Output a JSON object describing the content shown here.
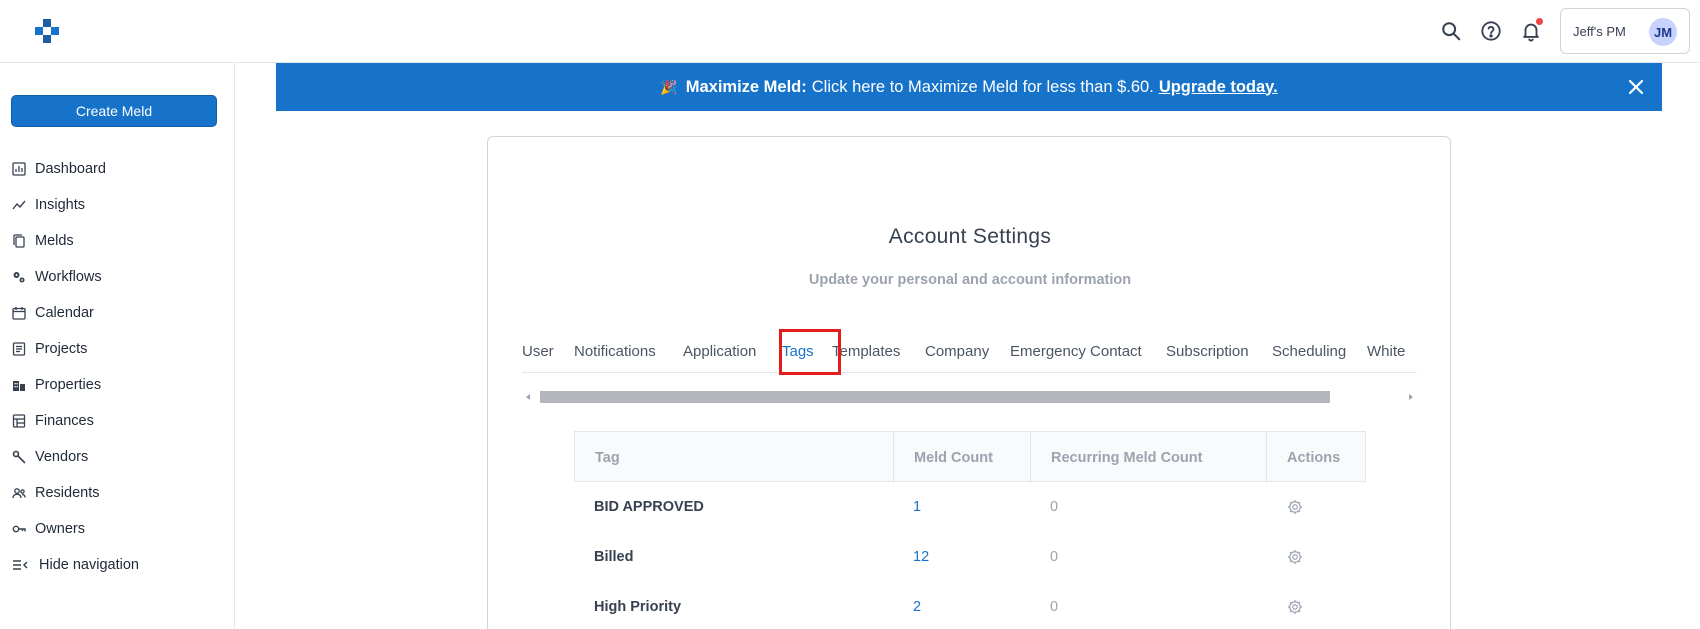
{
  "header": {
    "account_name": "Jeff's PM",
    "avatar_initials": "JM"
  },
  "sidebar": {
    "create_label": "Create Meld",
    "items": [
      {
        "label": "Dashboard",
        "icon": "dashboard-icon"
      },
      {
        "label": "Insights",
        "icon": "insights-icon"
      },
      {
        "label": "Melds",
        "icon": "melds-icon"
      },
      {
        "label": "Workflows",
        "icon": "workflows-icon"
      },
      {
        "label": "Calendar",
        "icon": "calendar-icon"
      },
      {
        "label": "Projects",
        "icon": "projects-icon"
      },
      {
        "label": "Properties",
        "icon": "properties-icon"
      },
      {
        "label": "Finances",
        "icon": "finances-icon"
      },
      {
        "label": "Vendors",
        "icon": "vendors-icon"
      },
      {
        "label": "Residents",
        "icon": "residents-icon"
      },
      {
        "label": "Owners",
        "icon": "owners-icon"
      },
      {
        "label": "Hide navigation",
        "icon": "hide-navigation-icon"
      }
    ]
  },
  "banner": {
    "party_emoji": "🎉",
    "bold": "Maximize Meld:",
    "text": "Click here to Maximize Meld for less than $.60.",
    "link": "Upgrade today."
  },
  "settings": {
    "title": "Account Settings",
    "subtitle": "Update your personal and account information",
    "tabs": [
      "User",
      "Notifications",
      "Application",
      "Tags",
      "Templates",
      "Company",
      "Emergency Contact",
      "Subscription",
      "Scheduling",
      "White"
    ],
    "active_tab": "Tags"
  },
  "table": {
    "headers": [
      "Tag",
      "Meld Count",
      "Recurring Meld Count",
      "Actions"
    ],
    "rows": [
      {
        "tag": "BID APPROVED",
        "count": "1",
        "recurring": "0"
      },
      {
        "tag": "Billed",
        "count": "12",
        "recurring": "0"
      },
      {
        "tag": "High Priority",
        "count": "2",
        "recurring": "0"
      }
    ]
  },
  "colors": {
    "primary": "#1673c9",
    "highlight": "#e11d1d",
    "notification_dot": "#ef4444"
  }
}
